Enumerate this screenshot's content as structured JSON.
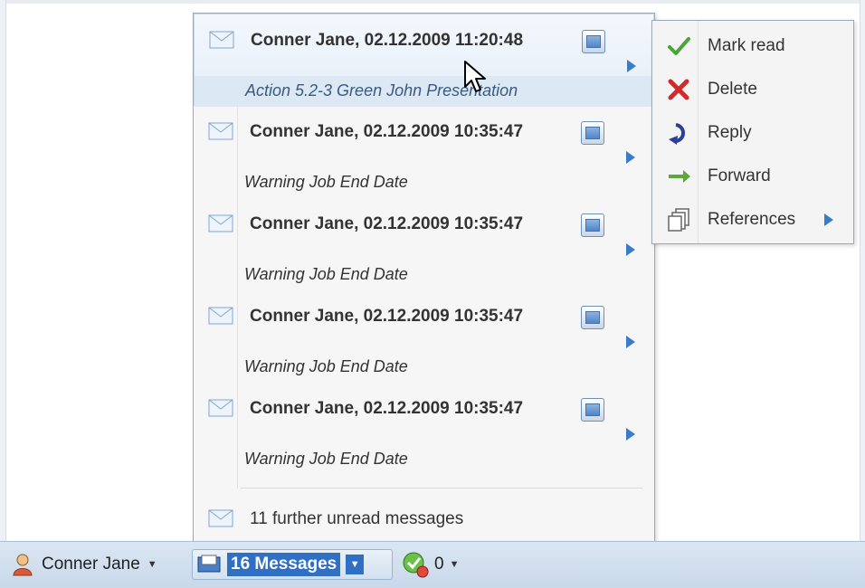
{
  "taskbar": {
    "user_name": "Conner Jane",
    "messages_label": "16 Messages",
    "tasks_count": "0"
  },
  "messages": [
    {
      "sender": "Conner Jane, 02.12.2009 11:20:48",
      "subject": "Action 5.2-3 Green John Presentation"
    },
    {
      "sender": "Conner Jane, 02.12.2009 10:35:47",
      "subject": "Warning Job End Date"
    },
    {
      "sender": "Conner Jane, 02.12.2009 10:35:47",
      "subject": "Warning Job End Date"
    },
    {
      "sender": "Conner Jane, 02.12.2009 10:35:47",
      "subject": "Warning Job End Date"
    },
    {
      "sender": "Conner Jane, 02.12.2009 10:35:47",
      "subject": "Warning Job End Date"
    }
  ],
  "further_unread": "11 further unread messages",
  "context_menu": [
    {
      "label": "Mark read",
      "icon": "checkmark-icon"
    },
    {
      "label": "Delete",
      "icon": "delete-x-icon"
    },
    {
      "label": "Reply",
      "icon": "reply-icon"
    },
    {
      "label": "Forward",
      "icon": "forward-arrow-icon"
    },
    {
      "label": "References",
      "icon": "references-icon"
    }
  ],
  "colors": {
    "accent": "#2f6fc4",
    "submenu_arrow": "#3a7cc8",
    "check": "#4aa43a",
    "delete": "#d02a2a",
    "reply": "#2a3f9a",
    "forward": "#5aa83a"
  }
}
